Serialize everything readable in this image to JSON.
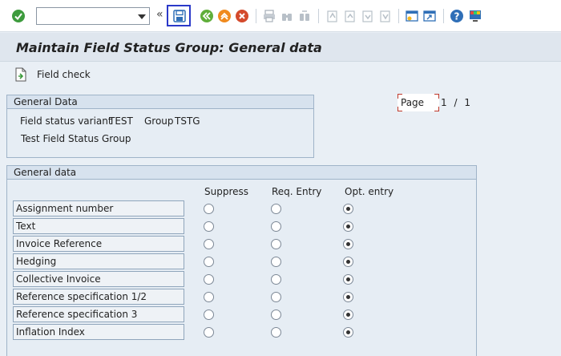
{
  "toolbar": {
    "command_placeholder": "",
    "chevron": "«",
    "colors": {
      "ok": "#3d9b3d",
      "back": "#5fae3a",
      "exit": "#f08a1e",
      "cancel": "#d44a2c",
      "help": "#2f6fb7",
      "highlight": "#2b39c9"
    }
  },
  "title": "Maintain Field Status Group: General data",
  "subtoolbar": {
    "field_check_label": "Field check"
  },
  "general_data_box": {
    "header": "General Data",
    "variant_label": "Field status variant",
    "variant_value": "TEST",
    "group_label": "Group",
    "group_value": "TSTG",
    "description": "Test Field Status Group"
  },
  "pager": {
    "label": "Page",
    "current": "1",
    "separator": "/",
    "total": "1"
  },
  "fields_box": {
    "header": "General data",
    "columns": {
      "suppress": "Suppress",
      "required": "Req. Entry",
      "optional": "Opt. entry"
    },
    "rows": [
      {
        "label": "Assignment number",
        "selected": "optional"
      },
      {
        "label": "Text",
        "selected": "optional"
      },
      {
        "label": "Invoice Reference",
        "selected": "optional"
      },
      {
        "label": "Hedging",
        "selected": "optional"
      },
      {
        "label": "Collective Invoice",
        "selected": "optional"
      },
      {
        "label": "Reference specification 1/2",
        "selected": "optional"
      },
      {
        "label": "Reference specification 3",
        "selected": "optional"
      },
      {
        "label": "Inflation Index",
        "selected": "optional"
      }
    ]
  }
}
